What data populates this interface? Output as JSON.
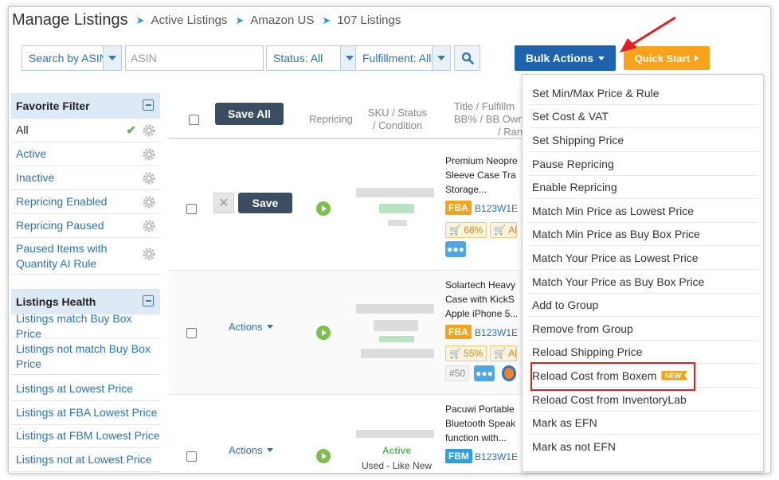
{
  "breadcrumb": {
    "title": "Manage Listings",
    "items": [
      "Active Listings",
      "Amazon US",
      "107 Listings"
    ]
  },
  "filters": {
    "search_by": "Search by ASIN",
    "asin_placeholder": "ASIN",
    "status": "Status: All",
    "fulfillment": "Fulfillment: All"
  },
  "buttons": {
    "bulk_actions": "Bulk Actions",
    "quick_start": "Quick Start",
    "save_all": "Save All",
    "save": "Save",
    "actions": "Actions"
  },
  "favorite_filter": {
    "title": "Favorite Filter",
    "items": [
      "All",
      "Active",
      "Inactive",
      "Repricing Enabled",
      "Repricing Paused",
      "Paused Items with Quantity AI Rule"
    ]
  },
  "listings_health": {
    "title": "Listings Health",
    "items": [
      "Listings match Buy Box Price",
      "Listings not match Buy Box Price",
      "Listings at Lowest Price",
      "Listings at FBA Lowest Price",
      "Listings at FBM Lowest Price",
      "Listings not at Lowest Price"
    ]
  },
  "table": {
    "headers": {
      "repricing": "Repricing",
      "sku": "SKU / Status / Condition",
      "title_line1": "Title / Fulfillm",
      "title_line2": "BB% / BB Owne",
      "title_line3": "/ Ran"
    },
    "rows": [
      {
        "title_lines": [
          "Premium Neopre",
          "Sleeve Case Tra",
          "Storage..."
        ],
        "fulfillment": "FBA",
        "asin": "B123W1E",
        "bb_percent": "68%",
        "extra_pill": "Al"
      },
      {
        "title_lines": [
          "Solartech Heavy",
          "Case with KickS",
          "Apple iPhone 5..."
        ],
        "fulfillment": "FBA",
        "asin": "B123W1E",
        "bb_percent": "55%",
        "extra_pill": "Al",
        "rank": "#50"
      },
      {
        "title_lines": [
          "Pacuwi Portable",
          "Bluetooth Speak",
          "function with..."
        ],
        "fulfillment": "FBM",
        "asin": "B123W1E",
        "status": "Active",
        "condition": "Used - Like New"
      }
    ]
  },
  "bulk_menu": {
    "items": [
      "Set Min/Max Price & Rule",
      "Set Cost & VAT",
      "Set Shipping Price",
      "Pause Repricing",
      "Enable Repricing",
      "Match Min Price as Lowest Price",
      "Match Min Price as Buy Box Price",
      "Match Your Price as Lowest Price",
      "Match Your Price as Buy Box Price",
      "Add to Group",
      "Remove from Group",
      "Reload Shipping Price",
      "Reload Cost from Boxem",
      "Reload Cost from InventoryLab",
      "Mark as EFN",
      "Mark as not EFN"
    ],
    "new_badge": "NEW"
  },
  "colors": {
    "primary": "#1d63ad",
    "accent": "#f9a21c",
    "link": "#2a73b6",
    "highlight": "#e02020"
  }
}
